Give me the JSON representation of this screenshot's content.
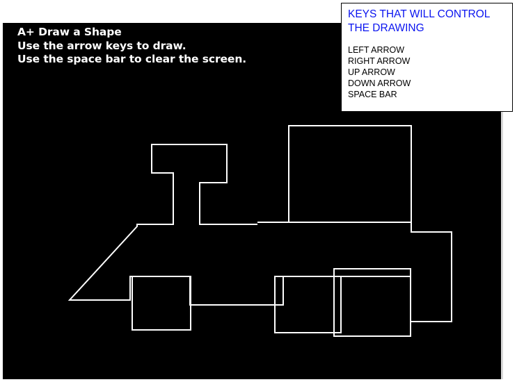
{
  "instructions": {
    "title": "A+ Draw a Shape",
    "line1": "Use the arrow keys to draw.",
    "line2": "Use the space bar to clear the screen."
  },
  "keys_panel": {
    "title_line1": "KEYS THAT WILL CONTROL",
    "title_line2": "THE DRAWING",
    "keys": [
      "LEFT ARROW",
      "RIGHT ARROW",
      "UP ARROW",
      "DOWN ARROW",
      "SPACE BAR"
    ]
  },
  "colors": {
    "canvas_background": "#000000",
    "drawing_stroke": "#ffffff",
    "panel_title": "#0a14f0",
    "panel_text": "#000000"
  }
}
